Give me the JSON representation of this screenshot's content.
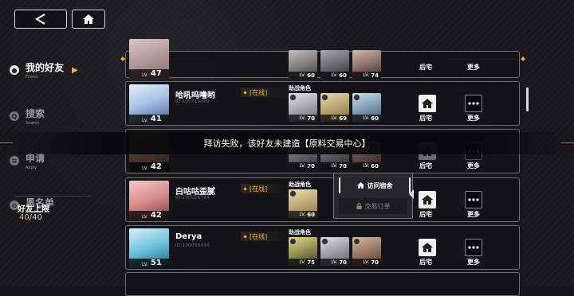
{
  "nav": {
    "back_icon": "chevron-left-icon",
    "home_icon": "home-icon"
  },
  "sidebar": {
    "items": [
      {
        "label": "我的好友",
        "sub": "Friend",
        "active": true
      },
      {
        "label": "搜索",
        "sub": "Search",
        "active": false
      },
      {
        "label": "申请",
        "sub": "Apply",
        "active": false
      },
      {
        "label": "黑名单",
        "sub": "Blacklist",
        "active": false
      }
    ],
    "limit_label": "好友上限",
    "limit_current": "40",
    "limit_max": "/40"
  },
  "labels": {
    "lv": "LV.",
    "chars_label": "助战角色",
    "dorm": "后宅",
    "more": "更多"
  },
  "friends": [
    {
      "level": "47",
      "chars": [
        "60",
        "60",
        "74"
      ]
    },
    {
      "name": "哈吼吗噜哟",
      "id": "ID:100710689",
      "status": "[在线]",
      "level": "41",
      "chars": [
        "70",
        "69",
        "60"
      ]
    },
    {
      "level": "42",
      "chars": [
        "70",
        "70",
        "60"
      ]
    },
    {
      "name": "白咕咕歪腻",
      "id": "ID:100056744",
      "status": "[在线]",
      "level": "42",
      "chars": [
        "60",
        "",
        ""
      ]
    },
    {
      "name": "Derya",
      "id": "ID:100058446",
      "status": "[在线]",
      "level": "51",
      "chars": [
        "75",
        "70",
        "70"
      ]
    }
  ],
  "toast": "拜访失败，该好友未建造【原料交易中心】",
  "popup": {
    "visit_dorm": "访问宿舍",
    "trade_order": "交易订单"
  },
  "colors": {
    "accent": "#f3b23a"
  }
}
